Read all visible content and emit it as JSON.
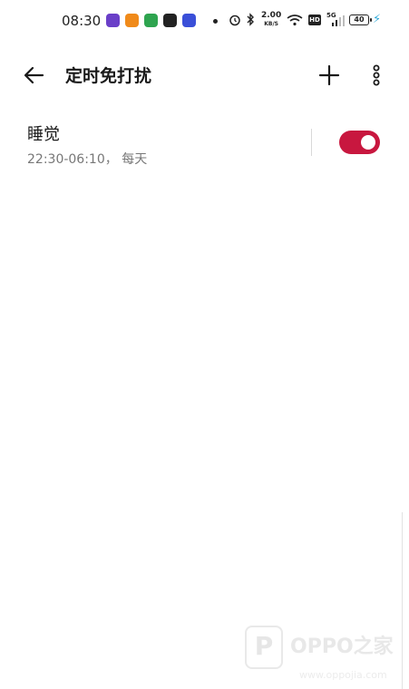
{
  "status_bar": {
    "time": "08:30",
    "net_speed_value": "2.00",
    "net_speed_unit": "KB/S",
    "hd_label": "HD",
    "network_type": "5G",
    "battery_level": "40",
    "app_icons": [
      "app-icon-purple",
      "weibo-icon",
      "app-icon-colorful",
      "wechat-icon",
      "app-icon-blue"
    ],
    "app_icon_colors": [
      "#6a3fc8",
      "#f08a1a",
      "#2ea44f",
      "#222222",
      "#3a4fd8"
    ],
    "icons": [
      "alarm-icon",
      "bluetooth-icon",
      "wifi-icon",
      "signal-icon",
      "battery-icon",
      "charging-icon"
    ]
  },
  "toolbar": {
    "title": "定时免打扰",
    "back_icon": "back-arrow-icon",
    "add_icon": "plus-icon",
    "more_icon": "more-vertical-icon"
  },
  "rules": [
    {
      "name": "睡觉",
      "detail": "22:30-06:10， 每天",
      "enabled": true
    }
  ],
  "watermark": {
    "brand": "OPPO之家",
    "url": "www.oppojia.com"
  },
  "colors": {
    "accent": "#c8173f",
    "background": "#ffffff",
    "secondary_text": "#777777"
  }
}
